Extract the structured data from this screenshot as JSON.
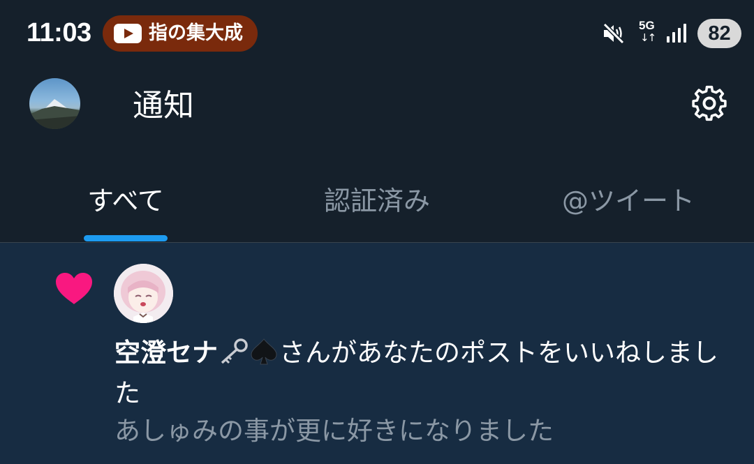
{
  "status_bar": {
    "time": "11:03",
    "media_text": "指の集大成",
    "network": "5G",
    "network_arrows": "↓↑",
    "battery": "82"
  },
  "header": {
    "title": "通知"
  },
  "tabs": [
    {
      "label": "すべて",
      "selected": true
    },
    {
      "label": "認証済み",
      "selected": false
    },
    {
      "label": "@ツイート",
      "selected": false
    }
  ],
  "notification": {
    "type_icon": "heart-icon",
    "user_name": "空澄セナ",
    "name_emojis": [
      "key-icon",
      "spade-icon"
    ],
    "action_text": "さんがあなたのポストをいいねしました",
    "tweet_preview": "あしゅみの事が更に好きになりました"
  },
  "colors": {
    "background": "#15202b",
    "notification_background": "#172c42",
    "accent": "#1d9bf0",
    "like": "#f91880",
    "secondary_text": "#8b98a5"
  }
}
